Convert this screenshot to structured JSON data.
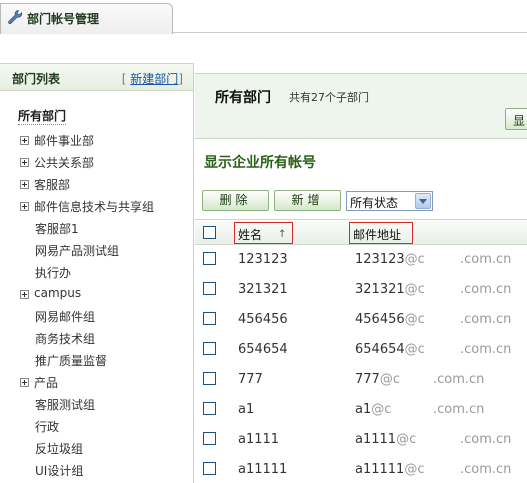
{
  "tab": {
    "label": "部门帐号管理"
  },
  "sidebar": {
    "title": "部门列表",
    "new_dept_open": "[ ",
    "new_dept_link": "新建部门",
    "new_dept_close": "]",
    "all_depts": "所有部门",
    "items": [
      {
        "label": "邮件事业部",
        "expandable": true
      },
      {
        "label": "公共关系部",
        "expandable": true
      },
      {
        "label": "客服部",
        "expandable": true
      },
      {
        "label": "邮件信息技术与共享组",
        "expandable": true
      },
      {
        "label": "客服部1",
        "expandable": false
      },
      {
        "label": "网易产品测试组",
        "expandable": false
      },
      {
        "label": "执行办",
        "expandable": false
      },
      {
        "label": "campus",
        "expandable": true
      },
      {
        "label": "网易邮件组",
        "expandable": false
      },
      {
        "label": "商务技术组",
        "expandable": false
      },
      {
        "label": "推广质量监督",
        "expandable": false
      },
      {
        "label": "产品",
        "expandable": true
      },
      {
        "label": "客服测试组",
        "expandable": false
      },
      {
        "label": "行政",
        "expandable": false
      },
      {
        "label": "反垃圾组",
        "expandable": false
      },
      {
        "label": "UI设计组",
        "expandable": false
      }
    ]
  },
  "header": {
    "title": "所有部门",
    "subtitle": "共有27个子部门",
    "cut_button": "显"
  },
  "section_title": "显示企业所有帐号",
  "toolbar": {
    "delete_label": "删除",
    "add_label": "新增",
    "status_select": "所有状态"
  },
  "table": {
    "col_name": "姓名",
    "sort_icon": "↑",
    "col_mail": "邮件地址",
    "rows": [
      {
        "name": "123123",
        "mail_user": "123123",
        "mail_at": "@c",
        "domain": ".com.cn"
      },
      {
        "name": "321321",
        "mail_user": "321321",
        "mail_at": "@c",
        "domain": ".com.cn"
      },
      {
        "name": "456456",
        "mail_user": "456456",
        "mail_at": "@c",
        "domain": ".com.cn"
      },
      {
        "name": "654654",
        "mail_user": "654654",
        "mail_at": "@c",
        "domain": ".com.cn"
      },
      {
        "name": "777",
        "mail_user": "777",
        "mail_at": "@c",
        "domain": ".com.cn"
      },
      {
        "name": "a1",
        "mail_user": "a1",
        "mail_at": "@c",
        "domain": ".com.cn"
      },
      {
        "name": "a1111",
        "mail_user": "a1111",
        "mail_at": "@c",
        "domain": ".com.cn"
      },
      {
        "name": "a11111",
        "mail_user": "a11111",
        "mail_at": "@c",
        "domain": ".com.cn"
      }
    ]
  },
  "colors": {
    "accent_green": "#2a6018",
    "header_bg": "#eef5ec",
    "highlight_red": "#d42a2a"
  }
}
